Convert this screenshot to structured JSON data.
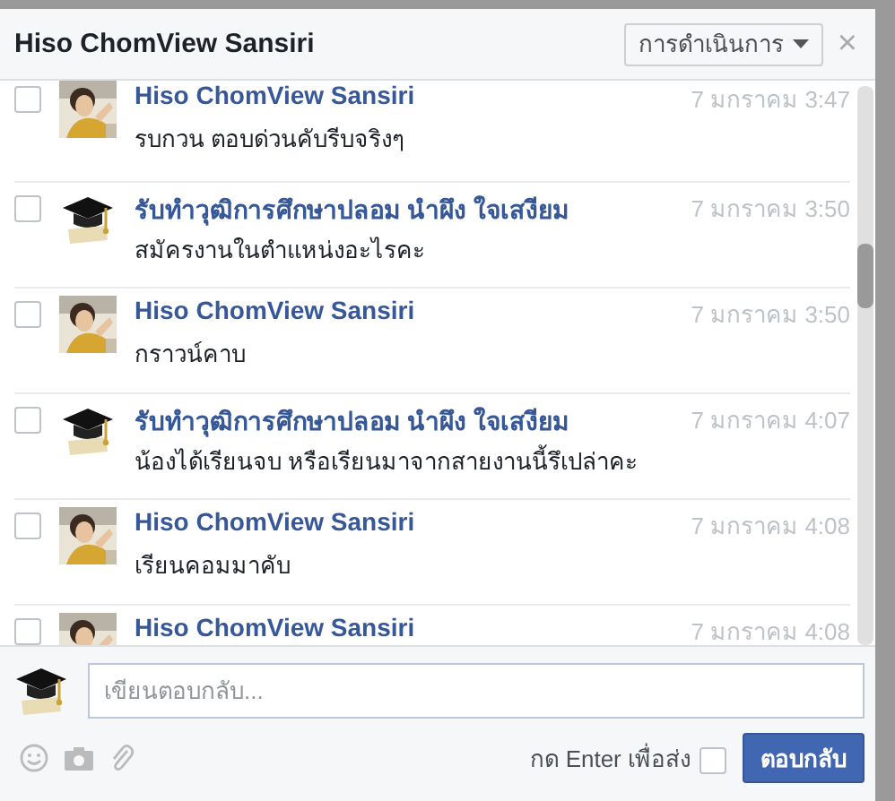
{
  "window": {
    "title": "Hiso ChomView Sansiri",
    "actions_button": "การดำเนินการ",
    "close": "×"
  },
  "messages": [
    {
      "sender": "Hiso ChomView Sansiri",
      "time": "7 มกราคม 3:47",
      "text": "รบกวน ตอบด่วนคับรีบจริงๆ",
      "checked": false
    },
    {
      "sender": "รับทำวุฒิการศึกษาปลอม นำผึง ใจเสงียม",
      "kind": "cap",
      "time": "7 มกราคม 3:50",
      "text": "สมัครงานในตำแหน่งอะไรคะ",
      "checked": false
    },
    {
      "sender": "Hiso ChomView Sansiri",
      "time": "7 มกราคม 3:50",
      "text": "กราวน์คาบ",
      "checked": false
    },
    {
      "sender": "รับทำวุฒิการศึกษาปลอม นำผึง ใจเสงียม",
      "kind": "cap",
      "time": "7 มกราคม 4:07",
      "text": "น้องได้เรียนจบ หรือเรียนมาจากสายงานนี้รึเปล่าคะ",
      "checked": false
    },
    {
      "sender": "Hiso ChomView Sansiri",
      "time": "7 มกราคม 4:08",
      "text": "เรียนคอมมาคับ",
      "checked": false
    },
    {
      "sender": "Hiso ChomView Sansiri",
      "time": "7 มกราคม 4:08",
      "checked": false
    }
  ],
  "composer": {
    "placeholder": "เขียนตอบกลับ...",
    "enter_label": "กด Enter เพื่อส่ง",
    "enter_checked": false,
    "send_button": "ตอบกลับ"
  }
}
